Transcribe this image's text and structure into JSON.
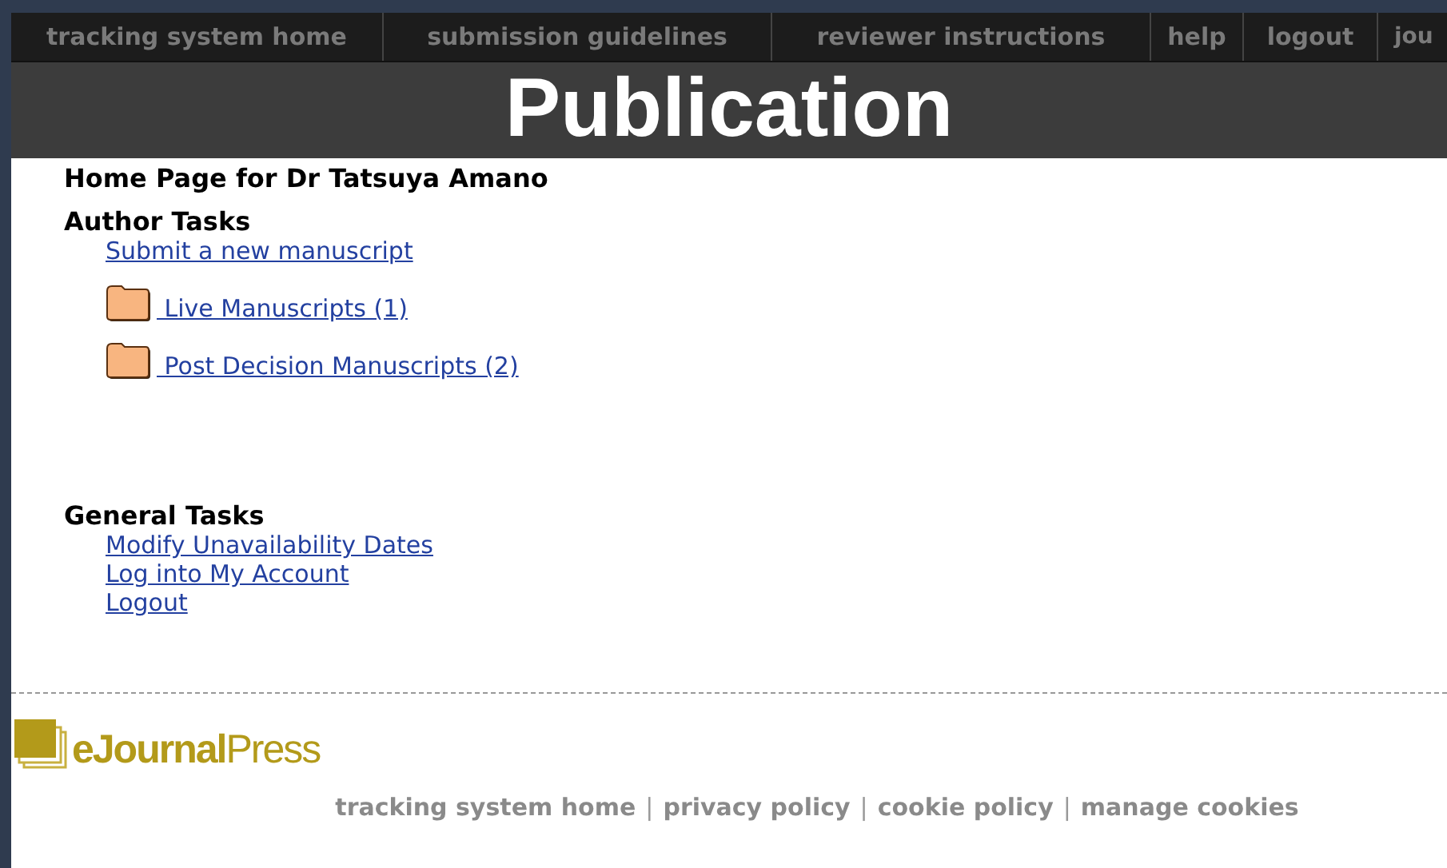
{
  "nav": [
    {
      "label": "tracking system home"
    },
    {
      "label": "submission guidelines"
    },
    {
      "label": "reviewer instructions"
    },
    {
      "label": "help"
    },
    {
      "label": "logout"
    },
    {
      "label": "jou"
    }
  ],
  "banner": {
    "title": "Publication"
  },
  "page_title": "Home Page for Dr Tatsuya Amano",
  "sections": [
    {
      "title": "Author Tasks",
      "items": [
        {
          "kind": "link",
          "label": "Submit a new manuscript"
        },
        {
          "kind": "folder",
          "label": " Live Manuscripts (1)"
        },
        {
          "kind": "folder",
          "label": " Post Decision Manuscripts (2)"
        }
      ]
    },
    {
      "title": "General Tasks",
      "items": [
        {
          "kind": "link",
          "label": "Modify Unavailability Dates"
        },
        {
          "kind": "link",
          "label": "Log into My Account"
        },
        {
          "kind": "link",
          "label": "Logout"
        }
      ]
    }
  ],
  "logo": "**eJournal**Press",
  "footer": {
    "separator": "|",
    "links": [
      "tracking system home",
      "privacy policy",
      "cookie policy",
      "manage cookies"
    ]
  }
}
